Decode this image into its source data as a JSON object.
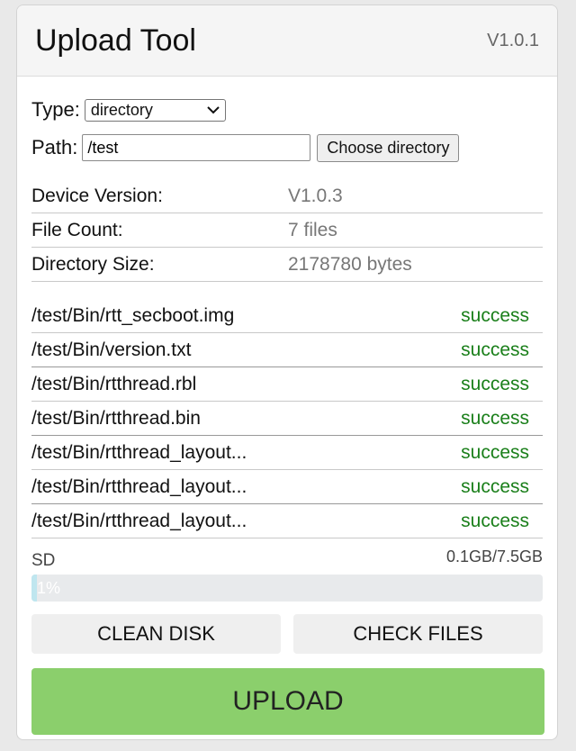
{
  "app": {
    "title": "Upload Tool",
    "version": "V1.0.1"
  },
  "form": {
    "type_label": "Type:",
    "type_value": "directory",
    "path_label": "Path:",
    "path_value": "/test",
    "choose_button": "Choose directory"
  },
  "info": [
    {
      "key": "Device Version:",
      "value": "V1.0.3"
    },
    {
      "key": "File Count:",
      "value": "7 files"
    },
    {
      "key": "Directory Size:",
      "value": "2178780 bytes"
    }
  ],
  "files": [
    {
      "path": "/test/Bin/rtt_secboot.img",
      "status": "success"
    },
    {
      "path": "/test/Bin/version.txt",
      "status": "success"
    },
    {
      "path": "/test/Bin/rtthread.rbl",
      "status": "success"
    },
    {
      "path": "/test/Bin/rtthread.bin",
      "status": "success"
    },
    {
      "path": "/test/Bin/rtthread_layout...",
      "status": "success"
    },
    {
      "path": "/test/Bin/rtthread_layout...",
      "status": "success"
    },
    {
      "path": "/test/Bin/rtthread_layout...",
      "status": "success"
    }
  ],
  "storage": {
    "label": "SD",
    "usage": "0.1GB/7.5GB",
    "percent_label": "1%",
    "percent": 1
  },
  "actions": {
    "clean_disk": "CLEAN DISK",
    "check_files": "CHECK FILES",
    "upload": "UPLOAD"
  },
  "colors": {
    "success": "#1a7f1a",
    "upload_button": "#8bcf6c",
    "progress_fill": "#bfe6ef"
  }
}
